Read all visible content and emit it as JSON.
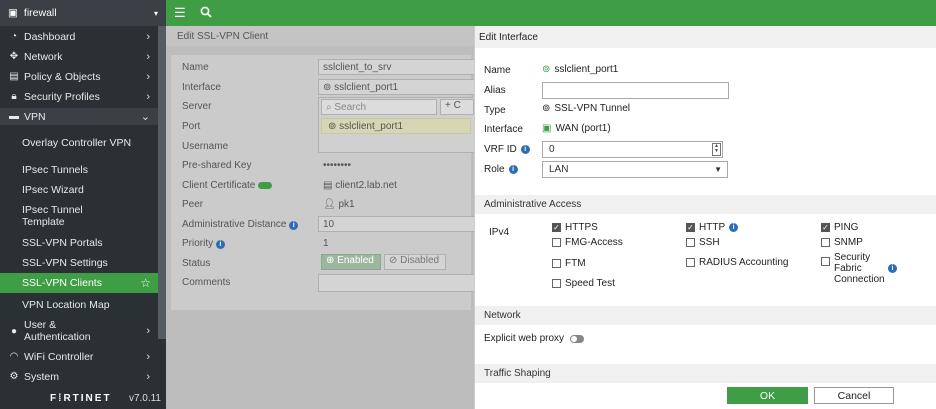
{
  "sidebar": {
    "header": "firewall",
    "items": [
      {
        "label": "Dashboard",
        "icon": "dashboard-icon"
      },
      {
        "label": "Network",
        "icon": "network-icon"
      },
      {
        "label": "Policy & Objects",
        "icon": "policy-icon"
      },
      {
        "label": "Security Profiles",
        "icon": "lock-icon"
      },
      {
        "label": "VPN",
        "icon": "vpn-icon"
      }
    ],
    "vpn_sub": [
      "Overlay Controller VPN",
      "IPsec Tunnels",
      "IPsec Wizard",
      "IPsec Tunnel Template",
      "SSL-VPN Portals",
      "SSL-VPN Settings",
      "SSL-VPN Clients",
      "VPN Location Map"
    ],
    "bottom_items": [
      {
        "label": "User & Authentication",
        "icon": "user-icon"
      },
      {
        "label": "WiFi Controller",
        "icon": "wifi-icon"
      },
      {
        "label": "System",
        "icon": "gear-icon"
      }
    ],
    "brand": "F⁞RTINET",
    "version": "v7.0.11"
  },
  "main": {
    "title": "Edit SSL-VPN Client",
    "rows": [
      {
        "label": "Name",
        "value": "sslclient_to_srv"
      },
      {
        "label": "Interface",
        "value": "sslclient_port1"
      },
      {
        "label": "Server",
        "value": ""
      },
      {
        "label": "Port",
        "value": ""
      },
      {
        "label": "Username",
        "value": ""
      },
      {
        "label": "Pre-shared Key",
        "value": "••••••••"
      },
      {
        "label": "Client Certificate",
        "value": "client2.lab.net"
      },
      {
        "label": "Peer",
        "value": "pk1"
      },
      {
        "label": "Administrative Distance",
        "value": "10"
      },
      {
        "label": "Priority",
        "value": "1"
      },
      {
        "label": "Status",
        "value": ""
      },
      {
        "label": "Comments",
        "value": ""
      }
    ],
    "search_placeholder": "Search",
    "create_label": "C",
    "dropdown_item": "sslclient_port1",
    "status_enabled": "Enabled",
    "status_disabled": "Disabled"
  },
  "modal": {
    "title": "Edit Interface",
    "name_label": "Name",
    "name_value": "sslclient_port1",
    "alias_label": "Alias",
    "alias_value": "",
    "type_label": "Type",
    "type_value": "SSL-VPN Tunnel",
    "interface_label": "Interface",
    "interface_value": "WAN (port1)",
    "vrf_label": "VRF ID",
    "vrf_value": "0",
    "role_label": "Role",
    "role_value": "LAN",
    "admin_access_section": "Administrative Access",
    "ipv4_label": "IPv4",
    "access": [
      {
        "label": "HTTPS",
        "checked": true
      },
      {
        "label": "HTTP",
        "checked": true
      },
      {
        "label": "PING",
        "checked": true
      },
      {
        "label": "FMG-Access",
        "checked": false
      },
      {
        "label": "SSH",
        "checked": false
      },
      {
        "label": "SNMP",
        "checked": false
      },
      {
        "label": "FTM",
        "checked": false
      },
      {
        "label": "RADIUS Accounting",
        "checked": false
      },
      {
        "label": "Security Fabric Connection",
        "checked": false
      },
      {
        "label": "Speed Test",
        "checked": false
      }
    ],
    "network_section": "Network",
    "explicit_proxy_label": "Explicit web proxy",
    "traffic_section": "Traffic Shaping",
    "ok_label": "OK",
    "cancel_label": "Cancel"
  },
  "colors": {
    "accent": "#3f9d45",
    "sidebar": "#2b3035",
    "info": "#2d6db5"
  }
}
